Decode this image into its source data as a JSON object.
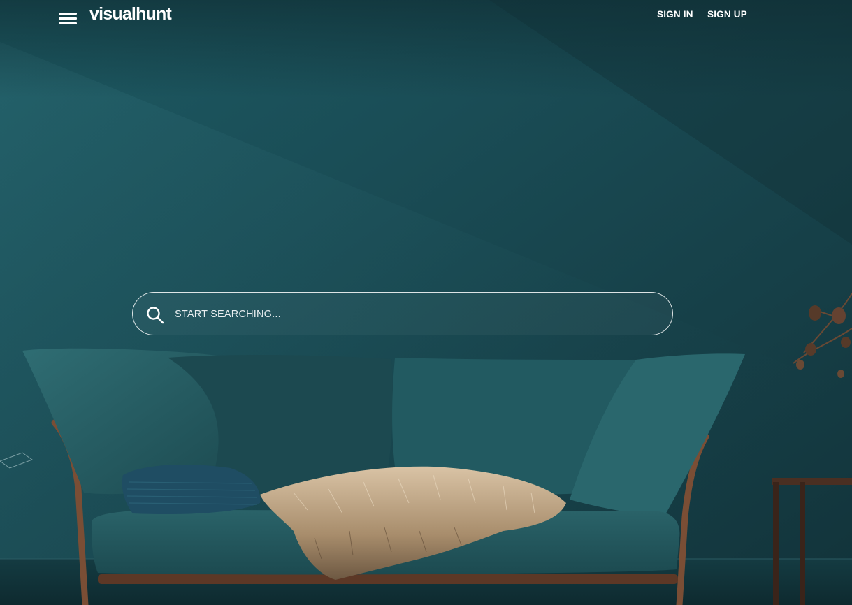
{
  "header": {
    "logo": "visualhunt",
    "menu_icon": "hamburger-menu-icon",
    "sign_in_label": "SIGN IN",
    "sign_up_label": "SIGN UP"
  },
  "search": {
    "placeholder": "START SEARCHING...",
    "value": "",
    "icon": "search-icon"
  },
  "colors": {
    "wall": "#1a4a52",
    "sofa": "#245a60",
    "text": "#ffffff"
  }
}
